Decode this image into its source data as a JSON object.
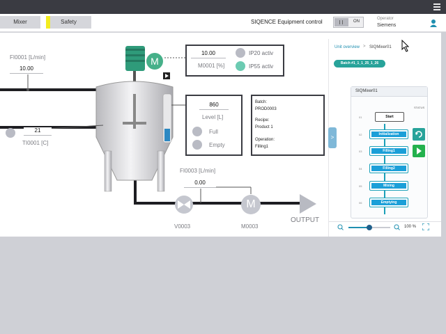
{
  "header": {
    "tabs": [
      {
        "label": "Mixer"
      },
      {
        "label": "Safety"
      }
    ],
    "equipment_title": "SIQENCE Equipment control",
    "toggle_label": "ON",
    "operator_label": "Operator",
    "operator_name": "Siemens"
  },
  "plant": {
    "fi0001": {
      "label": "FI0001 [L/min]",
      "value": "10.00"
    },
    "ti0001": {
      "label": "TI0001 [C]",
      "value": "21"
    },
    "m0001": {
      "value": "10.00",
      "label": "M0001 [%]",
      "ip20": "IP20 activ",
      "ip55": "IP55 activ",
      "motor_letter": "M"
    },
    "level": {
      "value": "860",
      "label": "Level [L]",
      "full": "Full",
      "empty": "Empty"
    },
    "info": {
      "batch_label": "Batch:",
      "batch_value": "PROD0003",
      "recipe_label": "Recipe:",
      "recipe_value": "Product 1",
      "operation_label": "Operation:",
      "operation_value": "Filling1"
    },
    "fi0003": {
      "label": "FI0003 [L/min]",
      "value": "0.00"
    },
    "v0003": {
      "label": "V0003"
    },
    "m0003": {
      "label": "M0003",
      "motor_letter": "M"
    },
    "output_label": "OUTPUT"
  },
  "right_panel": {
    "breadcrumb": [
      "Unit overview",
      "SIQMixer01"
    ],
    "breadcrumb_sep": ">",
    "batch": "Batch #1_1_1_25_1_26",
    "sequence_title": "SIQMixer01",
    "status_label": "STATUS",
    "steps": [
      {
        "label": "Start",
        "idx": "01"
      },
      {
        "label": "Initialization",
        "idx": "02"
      },
      {
        "label": "Filling1",
        "idx": "03"
      },
      {
        "label": "Filling2",
        "idx": "04"
      },
      {
        "label": "Mixing",
        "idx": "05"
      },
      {
        "label": "Emptying",
        "idx": "06"
      }
    ],
    "zoom_percent": "100 %",
    "zoom_level": 0.5,
    "side_tab": ">"
  },
  "colors": {
    "teal": "#28a39a",
    "step_blue": "#1b9fd8",
    "motor_green": "#46b089",
    "lamp_on": "#6ccbb2",
    "lamp_off": "#b9bbc4",
    "safety_yellow": "#f3ec1f",
    "action_green": "#23b14d"
  },
  "icons": [
    "menu-icon",
    "user-icon",
    "motor-icon",
    "valve-icon",
    "arrow-right-icon",
    "zoom-in-icon",
    "zoom-out-icon",
    "fullscreen-icon",
    "refresh-icon",
    "play-icon",
    "cursor-icon"
  ]
}
